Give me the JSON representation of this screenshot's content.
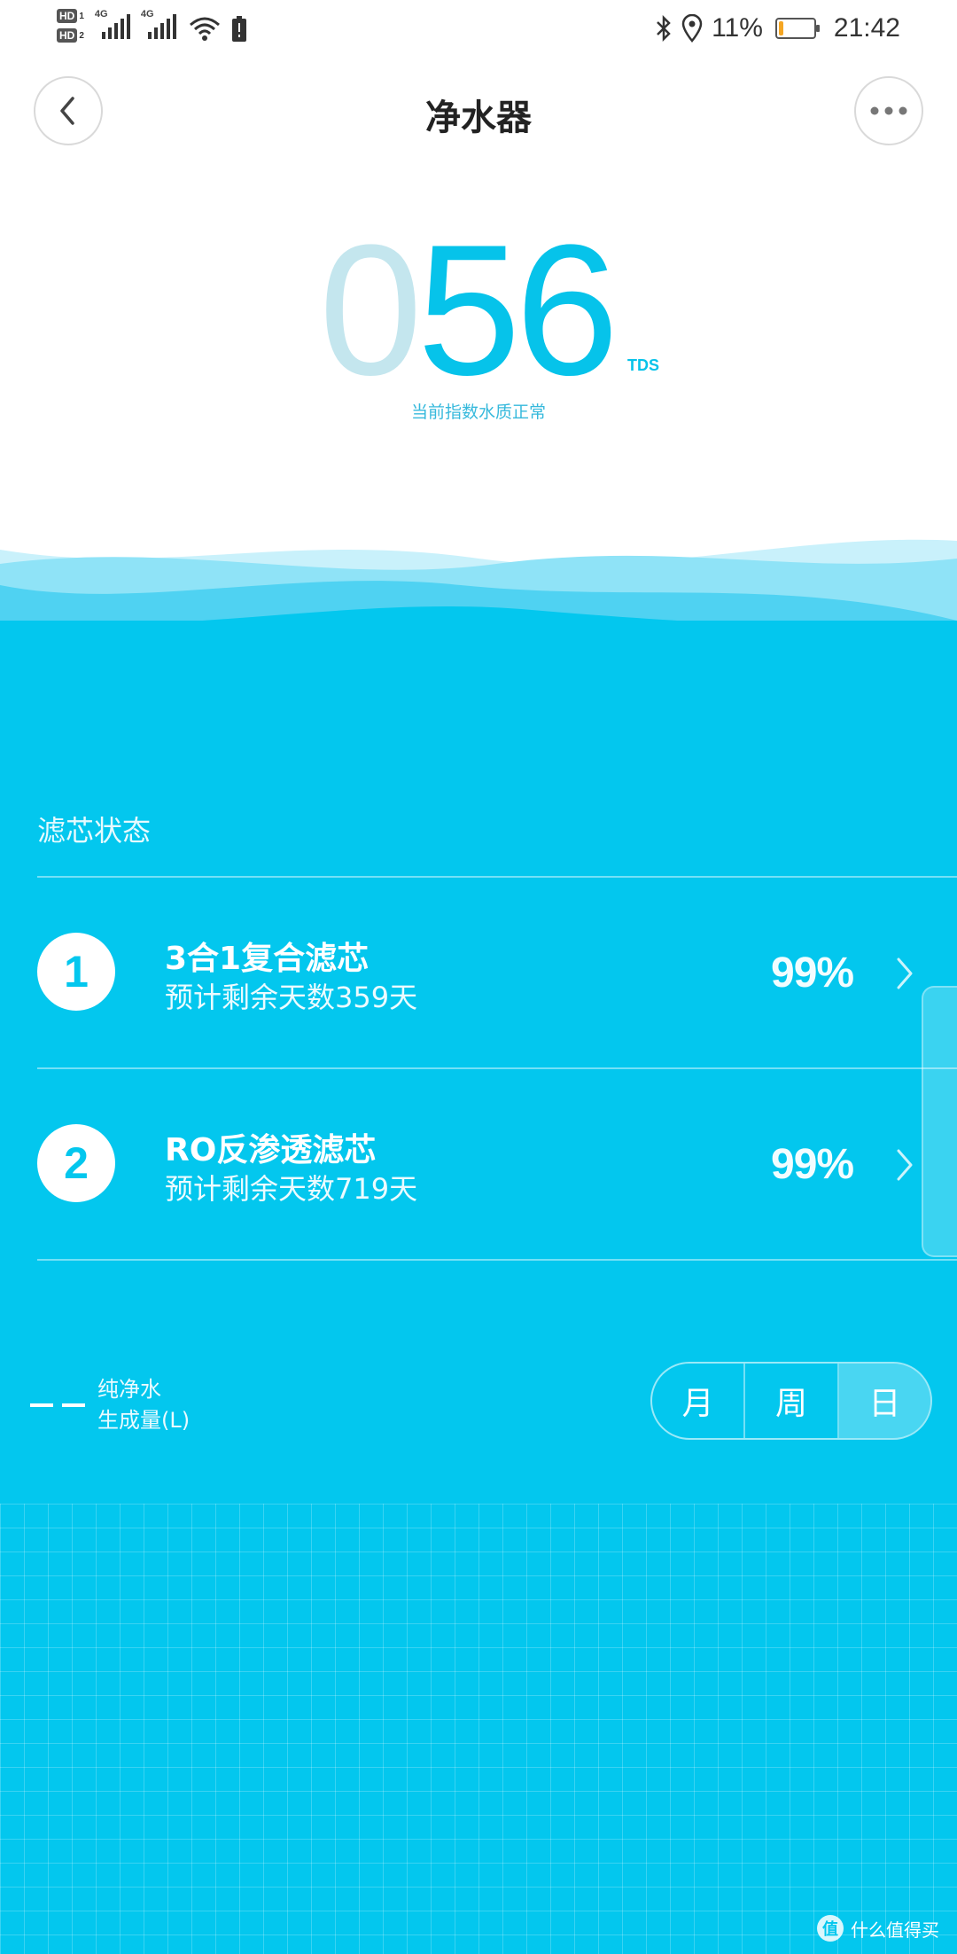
{
  "status_bar": {
    "hd1": "HD",
    "hd1_sub": "1",
    "hd2": "HD",
    "hd2_sub": "2",
    "network1": "4G",
    "network2": "4G",
    "battery_percent": "11%",
    "battery_level": 0.11,
    "time": "21:42"
  },
  "header": {
    "title": "净水器",
    "back_icon": "chevron-left-icon",
    "more_icon": "more-dots-icon"
  },
  "tds": {
    "digit_first": "0",
    "digits_rest": "56",
    "unit": "TDS",
    "status": "当前指数水质正常"
  },
  "filters": {
    "section_title": "滤芯状态",
    "items": [
      {
        "index": "1",
        "name": "3合1复合滤芯",
        "days": "预计剩余天数359天",
        "percent": "99%"
      },
      {
        "index": "2",
        "name": "RO反渗透滤芯",
        "days": "预计剩余天数719天",
        "percent": "99%"
      }
    ]
  },
  "chart": {
    "legend_line1": "纯净水",
    "legend_line2": "生成量(L)",
    "segments": [
      "月",
      "周",
      "日"
    ],
    "selected_segment": "日"
  },
  "watermark": {
    "badge": "值",
    "text": "什么值得买"
  },
  "colors": {
    "accent": "#03c7ee",
    "tds_faded": "#c4e6ee",
    "battery": "#f5a623"
  }
}
